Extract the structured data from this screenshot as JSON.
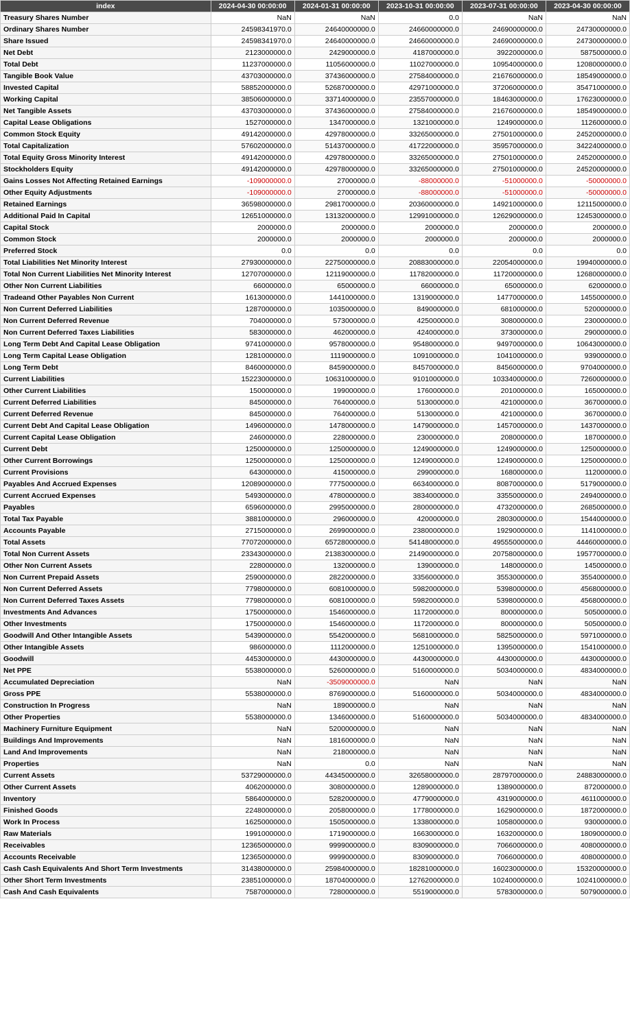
{
  "table": {
    "columns": [
      "index",
      "2024-04-30 00:00:00",
      "2024-01-31 00:00:00",
      "2023-10-31 00:00:00",
      "2023-07-31 00:00:00",
      "2023-04-30 00:00:00"
    ],
    "rows": [
      [
        "Treasury Shares Number",
        "NaN",
        "NaN",
        "0.0",
        "NaN",
        "NaN"
      ],
      [
        "Ordinary Shares Number",
        "24598341970.0",
        "24640000000.0",
        "24660000000.0",
        "24690000000.0",
        "24730000000.0"
      ],
      [
        "Share Issued",
        "24598341970.0",
        "24640000000.0",
        "24660000000.0",
        "24690000000.0",
        "24730000000.0"
      ],
      [
        "Net Debt",
        "2123000000.0",
        "2429000000.0",
        "4187000000.0",
        "3922000000.0",
        "5875000000.0"
      ],
      [
        "Total Debt",
        "11237000000.0",
        "11056000000.0",
        "11027000000.0",
        "10954000000.0",
        "12080000000.0"
      ],
      [
        "Tangible Book Value",
        "43703000000.0",
        "37436000000.0",
        "27584000000.0",
        "21676000000.0",
        "18549000000.0"
      ],
      [
        "Invested Capital",
        "58852000000.0",
        "52687000000.0",
        "42971000000.0",
        "37206000000.0",
        "35471000000.0"
      ],
      [
        "Working Capital",
        "38506000000.0",
        "33714000000.0",
        "23557000000.0",
        "18463000000.0",
        "17623000000.0"
      ],
      [
        "Net Tangible Assets",
        "43703000000.0",
        "37436000000.0",
        "27584000000.0",
        "21676000000.0",
        "18549000000.0"
      ],
      [
        "Capital Lease Obligations",
        "1527000000.0",
        "1347000000.0",
        "1321000000.0",
        "1249000000.0",
        "1126000000.0"
      ],
      [
        "Common Stock Equity",
        "49142000000.0",
        "42978000000.0",
        "33265000000.0",
        "27501000000.0",
        "24520000000.0"
      ],
      [
        "Total Capitalization",
        "57602000000.0",
        "51437000000.0",
        "41722000000.0",
        "35957000000.0",
        "34224000000.0"
      ],
      [
        "Total Equity Gross Minority Interest",
        "49142000000.0",
        "42978000000.0",
        "33265000000.0",
        "27501000000.0",
        "24520000000.0"
      ],
      [
        "Stockholders Equity",
        "49142000000.0",
        "42978000000.0",
        "33265000000.0",
        "27501000000.0",
        "24520000000.0"
      ],
      [
        "Gains Losses Not Affecting Retained Earnings",
        "-109000000.0",
        "27000000.0",
        "-88000000.0",
        "-51000000.0",
        "-50000000.0"
      ],
      [
        "Other Equity Adjustments",
        "-109000000.0",
        "27000000.0",
        "-88000000.0",
        "-51000000.0",
        "-50000000.0"
      ],
      [
        "Retained Earnings",
        "36598000000.0",
        "29817000000.0",
        "20360000000.0",
        "14921000000.0",
        "12115000000.0"
      ],
      [
        "Additional Paid In Capital",
        "12651000000.0",
        "13132000000.0",
        "12991000000.0",
        "12629000000.0",
        "12453000000.0"
      ],
      [
        "Capital Stock",
        "2000000.0",
        "2000000.0",
        "2000000.0",
        "2000000.0",
        "2000000.0"
      ],
      [
        "Common Stock",
        "2000000.0",
        "2000000.0",
        "2000000.0",
        "2000000.0",
        "2000000.0"
      ],
      [
        "Preferred Stock",
        "0.0",
        "0.0",
        "0.0",
        "0.0",
        "0.0"
      ],
      [
        "Total Liabilities Net Minority Interest",
        "27930000000.0",
        "22750000000.0",
        "20883000000.0",
        "22054000000.0",
        "19940000000.0"
      ],
      [
        "Total Non Current Liabilities Net Minority Interest",
        "12707000000.0",
        "12119000000.0",
        "11782000000.0",
        "11720000000.0",
        "12680000000.0"
      ],
      [
        "Other Non Current Liabilities",
        "66000000.0",
        "65000000.0",
        "66000000.0",
        "65000000.0",
        "62000000.0"
      ],
      [
        "Tradeand Other Payables Non Current",
        "1613000000.0",
        "1441000000.0",
        "1319000000.0",
        "1477000000.0",
        "1455000000.0"
      ],
      [
        "Non Current Deferred Liabilities",
        "1287000000.0",
        "1035000000.0",
        "849000000.0",
        "681000000.0",
        "520000000.0"
      ],
      [
        "Non Current Deferred Revenue",
        "704000000.0",
        "573000000.0",
        "425000000.0",
        "308000000.0",
        "230000000.0"
      ],
      [
        "Non Current Deferred Taxes Liabilities",
        "583000000.0",
        "462000000.0",
        "424000000.0",
        "373000000.0",
        "290000000.0"
      ],
      [
        "Long Term Debt And Capital Lease Obligation",
        "9741000000.0",
        "9578000000.0",
        "9548000000.0",
        "9497000000.0",
        "10643000000.0"
      ],
      [
        "Long Term Capital Lease Obligation",
        "1281000000.0",
        "1119000000.0",
        "1091000000.0",
        "1041000000.0",
        "939000000.0"
      ],
      [
        "Long Term Debt",
        "8460000000.0",
        "8459000000.0",
        "8457000000.0",
        "8456000000.0",
        "9704000000.0"
      ],
      [
        "Current Liabilities",
        "15223000000.0",
        "10631000000.0",
        "9101000000.0",
        "10334000000.0",
        "7260000000.0"
      ],
      [
        "Other Current Liabilities",
        "150000000.0",
        "199000000.0",
        "176000000.0",
        "201000000.0",
        "165000000.0"
      ],
      [
        "Current Deferred Liabilities",
        "845000000.0",
        "764000000.0",
        "513000000.0",
        "421000000.0",
        "367000000.0"
      ],
      [
        "Current Deferred Revenue",
        "845000000.0",
        "764000000.0",
        "513000000.0",
        "421000000.0",
        "367000000.0"
      ],
      [
        "Current Debt And Capital Lease Obligation",
        "1496000000.0",
        "1478000000.0",
        "1479000000.0",
        "1457000000.0",
        "1437000000.0"
      ],
      [
        "Current Capital Lease Obligation",
        "246000000.0",
        "228000000.0",
        "230000000.0",
        "208000000.0",
        "187000000.0"
      ],
      [
        "Current Debt",
        "1250000000.0",
        "1250000000.0",
        "1249000000.0",
        "1249000000.0",
        "1250000000.0"
      ],
      [
        "Other Current Borrowings",
        "1250000000.0",
        "1250000000.0",
        "1249000000.0",
        "1249000000.0",
        "1250000000.0"
      ],
      [
        "Current Provisions",
        "643000000.0",
        "415000000.0",
        "299000000.0",
        "168000000.0",
        "112000000.0"
      ],
      [
        "Payables And Accrued Expenses",
        "12089000000.0",
        "7775000000.0",
        "6634000000.0",
        "8087000000.0",
        "5179000000.0"
      ],
      [
        "Current Accrued Expenses",
        "5493000000.0",
        "4780000000.0",
        "3834000000.0",
        "3355000000.0",
        "2494000000.0"
      ],
      [
        "Payables",
        "6596000000.0",
        "2995000000.0",
        "2800000000.0",
        "4732000000.0",
        "2685000000.0"
      ],
      [
        "Total Tax Payable",
        "3881000000.0",
        "296000000.0",
        "420000000.0",
        "2803000000.0",
        "1544000000.0"
      ],
      [
        "Accounts Payable",
        "2715000000.0",
        "2699000000.0",
        "2380000000.0",
        "1929000000.0",
        "1141000000.0"
      ],
      [
        "Total Assets",
        "77072000000.0",
        "65728000000.0",
        "54148000000.0",
        "49555000000.0",
        "44460000000.0"
      ],
      [
        "Total Non Current Assets",
        "23343000000.0",
        "21383000000.0",
        "21490000000.0",
        "20758000000.0",
        "19577000000.0"
      ],
      [
        "Other Non Current Assets",
        "228000000.0",
        "132000000.0",
        "139000000.0",
        "148000000.0",
        "145000000.0"
      ],
      [
        "Non Current Prepaid Assets",
        "2590000000.0",
        "2822000000.0",
        "3356000000.0",
        "3553000000.0",
        "3554000000.0"
      ],
      [
        "Non Current Deferred Assets",
        "7798000000.0",
        "6081000000.0",
        "5982000000.0",
        "5398000000.0",
        "4568000000.0"
      ],
      [
        "Non Current Deferred Taxes Assets",
        "7798000000.0",
        "6081000000.0",
        "5982000000.0",
        "5398000000.0",
        "4568000000.0"
      ],
      [
        "Investments And Advances",
        "1750000000.0",
        "1546000000.0",
        "1172000000.0",
        "800000000.0",
        "505000000.0"
      ],
      [
        "Other Investments",
        "1750000000.0",
        "1546000000.0",
        "1172000000.0",
        "800000000.0",
        "505000000.0"
      ],
      [
        "Goodwill And Other Intangible Assets",
        "5439000000.0",
        "5542000000.0",
        "5681000000.0",
        "5825000000.0",
        "5971000000.0"
      ],
      [
        "Other Intangible Assets",
        "986000000.0",
        "1112000000.0",
        "1251000000.0",
        "1395000000.0",
        "1541000000.0"
      ],
      [
        "Goodwill",
        "4453000000.0",
        "4430000000.0",
        "4430000000.0",
        "4430000000.0",
        "4430000000.0"
      ],
      [
        "Net PPE",
        "5538000000.0",
        "5260000000.0",
        "5160000000.0",
        "5034000000.0",
        "4834000000.0"
      ],
      [
        "Accumulated Depreciation",
        "NaN",
        "-3509000000.0",
        "NaN",
        "NaN",
        "NaN"
      ],
      [
        "Gross PPE",
        "5538000000.0",
        "8769000000.0",
        "5160000000.0",
        "5034000000.0",
        "4834000000.0"
      ],
      [
        "Construction In Progress",
        "NaN",
        "189000000.0",
        "NaN",
        "NaN",
        "NaN"
      ],
      [
        "Other Properties",
        "5538000000.0",
        "1346000000.0",
        "5160000000.0",
        "5034000000.0",
        "4834000000.0"
      ],
      [
        "Machinery Furniture Equipment",
        "NaN",
        "5200000000.0",
        "NaN",
        "NaN",
        "NaN"
      ],
      [
        "Buildings And Improvements",
        "NaN",
        "1816000000.0",
        "NaN",
        "NaN",
        "NaN"
      ],
      [
        "Land And Improvements",
        "NaN",
        "218000000.0",
        "NaN",
        "NaN",
        "NaN"
      ],
      [
        "Properties",
        "NaN",
        "0.0",
        "NaN",
        "NaN",
        "NaN"
      ],
      [
        "Current Assets",
        "53729000000.0",
        "44345000000.0",
        "32658000000.0",
        "28797000000.0",
        "24883000000.0"
      ],
      [
        "Other Current Assets",
        "4062000000.0",
        "3080000000.0",
        "1289000000.0",
        "1389000000.0",
        "872000000.0"
      ],
      [
        "Inventory",
        "5864000000.0",
        "5282000000.0",
        "4779000000.0",
        "4319000000.0",
        "4611000000.0"
      ],
      [
        "Finished Goods",
        "2248000000.0",
        "2058000000.0",
        "1778000000.0",
        "1629000000.0",
        "1872000000.0"
      ],
      [
        "Work In Process",
        "1625000000.0",
        "1505000000.0",
        "1338000000.0",
        "1058000000.0",
        "930000000.0"
      ],
      [
        "Raw Materials",
        "1991000000.0",
        "1719000000.0",
        "1663000000.0",
        "1632000000.0",
        "1809000000.0"
      ],
      [
        "Receivables",
        "12365000000.0",
        "9999000000.0",
        "8309000000.0",
        "7066000000.0",
        "4080000000.0"
      ],
      [
        "Accounts Receivable",
        "12365000000.0",
        "9999000000.0",
        "8309000000.0",
        "7066000000.0",
        "4080000000.0"
      ],
      [
        "Cash Cash Equivalents And Short Term Investments",
        "31438000000.0",
        "25984000000.0",
        "18281000000.0",
        "16023000000.0",
        "15320000000.0"
      ],
      [
        "Other Short Term Investments",
        "23851000000.0",
        "18704000000.0",
        "12762000000.0",
        "10240000000.0",
        "10241000000.0"
      ],
      [
        "Cash And Cash Equivalents",
        "7587000000.0",
        "7280000000.0",
        "5519000000.0",
        "5783000000.0",
        "5079000000.0"
      ]
    ]
  }
}
